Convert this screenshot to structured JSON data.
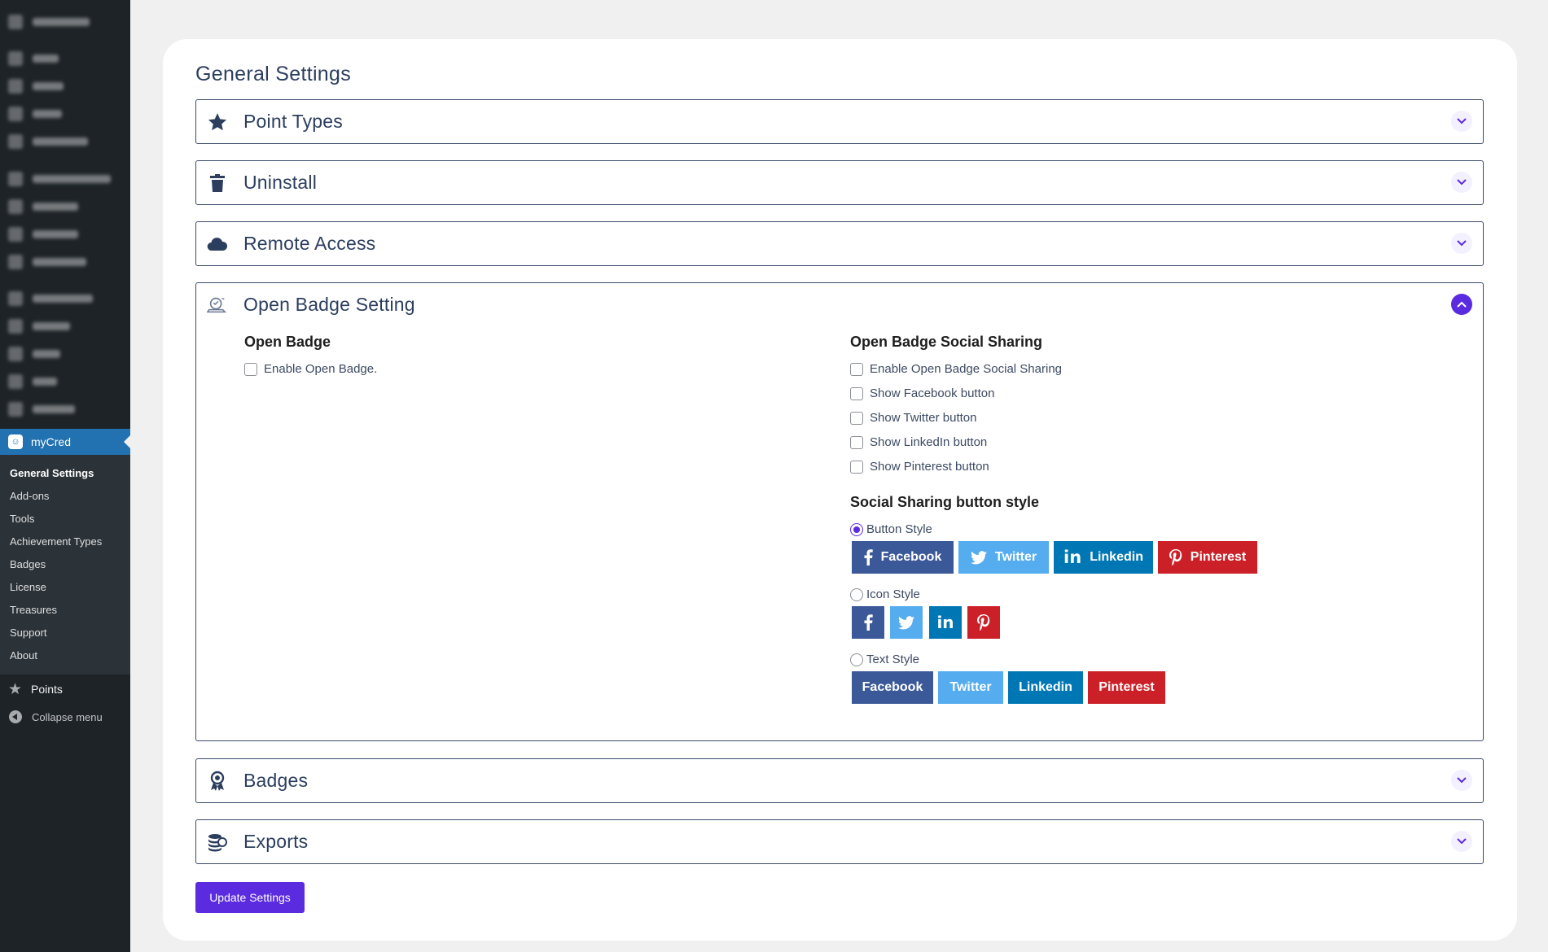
{
  "sidebar": {
    "mycred_label": "myCred",
    "submenu": [
      "General Settings",
      "Add-ons",
      "Tools",
      "Achievement Types",
      "Badges",
      "License",
      "Treasures",
      "Support",
      "About"
    ],
    "points_label": "Points",
    "collapse_label": "Collapse menu"
  },
  "page": {
    "title": "General Settings",
    "update_button": "Update Settings"
  },
  "panels": {
    "point_types": {
      "title": "Point Types",
      "icon": "star-icon"
    },
    "uninstall": {
      "title": "Uninstall",
      "icon": "trash-icon"
    },
    "remote_access": {
      "title": "Remote Access",
      "icon": "cloud-icon"
    },
    "open_badge": {
      "title": "Open Badge Setting",
      "icon": "badge-settings-icon",
      "expanded": true
    },
    "badges": {
      "title": "Badges",
      "icon": "award-icon"
    },
    "exports": {
      "title": "Exports",
      "icon": "coins-icon"
    }
  },
  "open_badge": {
    "left_heading": "Open Badge",
    "enable_label": "Enable Open Badge.",
    "right_heading": "Open Badge Social Sharing",
    "sharing_options": [
      "Enable Open Badge Social Sharing",
      "Show Facebook button",
      "Show Twitter button",
      "Show LinkedIn button",
      "Show Pinterest button"
    ],
    "style_heading": "Social Sharing button style",
    "styles": {
      "button": "Button Style",
      "icon": "Icon Style",
      "text": "Text Style"
    },
    "selected_style": "Button Style",
    "networks": {
      "facebook": "Facebook",
      "twitter": "Twitter",
      "linkedin": "Linkedin",
      "pinterest": "Pinterest"
    }
  },
  "colors": {
    "accent": "#5b2be0",
    "facebook": "#3b5998",
    "twitter": "#55acee",
    "linkedin": "#0077b5",
    "pinterest": "#cb2027",
    "sidebar": "#1d2327",
    "wp_blue": "#2271b1"
  }
}
